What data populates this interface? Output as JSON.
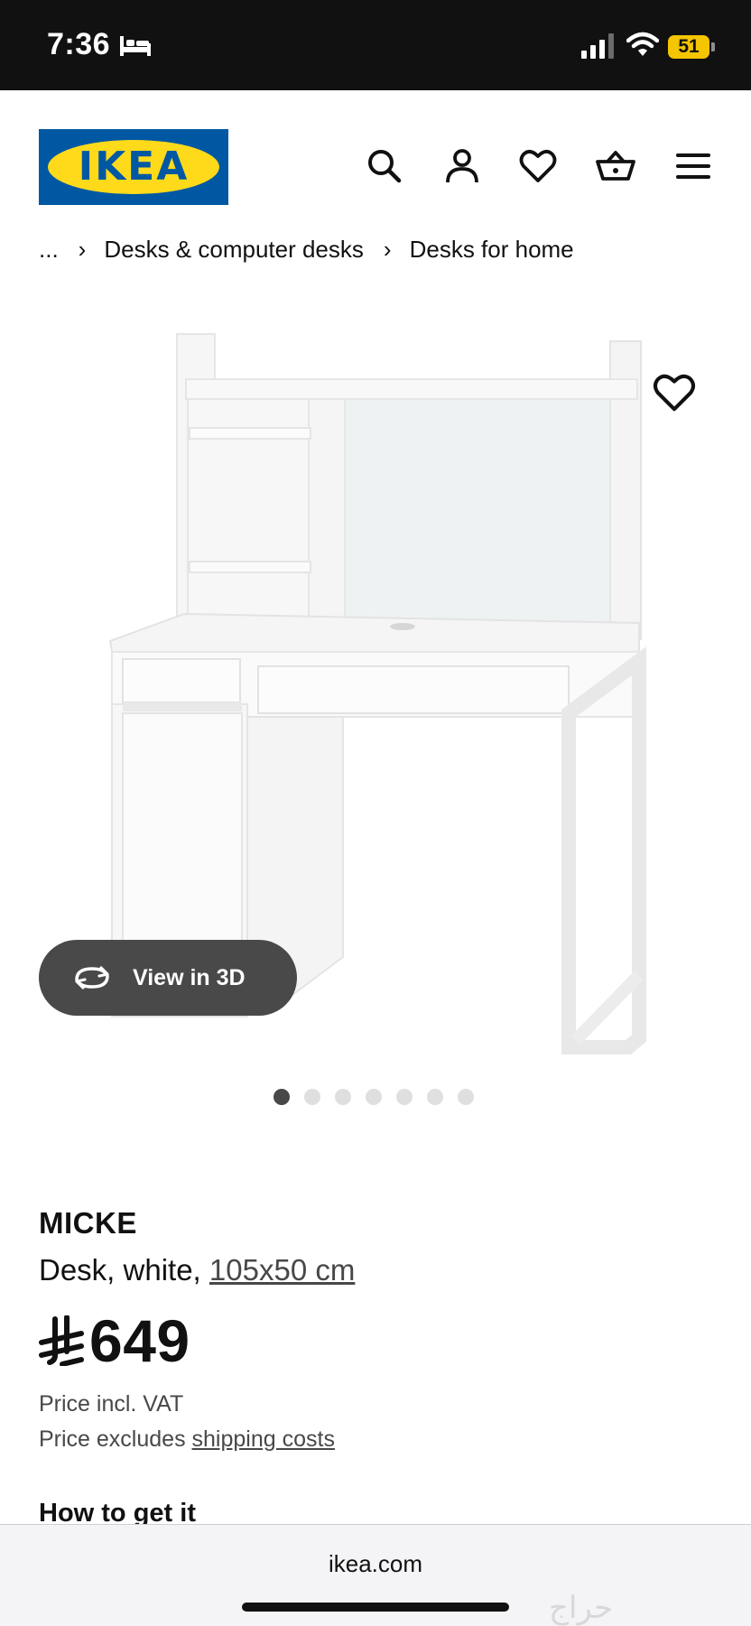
{
  "status_bar": {
    "time": "7:36",
    "battery_level": "51",
    "icons": [
      "bed-icon",
      "signal-icon",
      "wifi-icon",
      "battery-icon"
    ],
    "battery_color": "#f4c500"
  },
  "header": {
    "logo_text": "IKEA",
    "brand_colors": {
      "blue": "#0058a3",
      "yellow": "#ffda1a"
    },
    "icons": [
      "search-icon",
      "account-icon",
      "wishlist-heart-icon",
      "cart-basket-icon",
      "menu-icon"
    ]
  },
  "breadcrumb": {
    "ellipsis": "...",
    "items": [
      "Desks & computer desks",
      "Desks for home"
    ],
    "separator": "›"
  },
  "gallery": {
    "image_alt_icon": "product-desk-image",
    "view_3d_label": "View in 3D",
    "favorite_icon": "heart-icon",
    "dot_count": 7,
    "active_index": 0
  },
  "product": {
    "name": "MICKE",
    "description": "Desk, white, ",
    "size": "105x50 cm",
    "currency_icon": "saudi-riyal-icon",
    "price": "649",
    "price_note": "Price incl. VAT",
    "shipping_prefix": "Price excludes ",
    "shipping_link": "shipping costs"
  },
  "how_to_get": {
    "heading": "How to get it"
  },
  "browser": {
    "url": "ikea.com",
    "watermark": "حراج"
  }
}
